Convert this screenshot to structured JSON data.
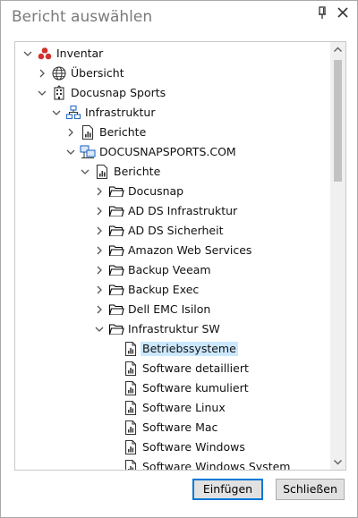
{
  "window": {
    "title": "Bericht auswählen"
  },
  "tree": {
    "items": [
      {
        "label": "Inventar",
        "icon": "inventar-icon",
        "expander": "expanded"
      },
      {
        "label": "Übersicht",
        "icon": "globe-icon",
        "expander": "collapsed"
      },
      {
        "label": "Docusnap Sports",
        "icon": "building-icon",
        "expander": "expanded"
      },
      {
        "label": "Infrastruktur",
        "icon": "network-icon",
        "expander": "expanded"
      },
      {
        "label": "Berichte",
        "icon": "report-icon",
        "expander": "collapsed"
      },
      {
        "label": "DOCUSNAPSPORTS.COM",
        "icon": "domain-icon",
        "expander": "expanded"
      },
      {
        "label": "Berichte",
        "icon": "report-icon",
        "expander": "expanded"
      },
      {
        "label": "Docusnap",
        "icon": "folder-icon",
        "expander": "collapsed"
      },
      {
        "label": "AD DS Infrastruktur",
        "icon": "folder-icon",
        "expander": "collapsed"
      },
      {
        "label": "AD DS Sicherheit",
        "icon": "folder-icon",
        "expander": "collapsed"
      },
      {
        "label": "Amazon Web Services",
        "icon": "folder-icon",
        "expander": "collapsed"
      },
      {
        "label": "Backup Veeam",
        "icon": "folder-icon",
        "expander": "collapsed"
      },
      {
        "label": "Backup Exec",
        "icon": "folder-icon",
        "expander": "collapsed"
      },
      {
        "label": "Dell EMC Isilon",
        "icon": "folder-icon",
        "expander": "collapsed"
      },
      {
        "label": "Infrastruktur SW",
        "icon": "folder-icon",
        "expander": "expanded"
      },
      {
        "label": "Betriebssysteme",
        "icon": "report-page-icon",
        "expander": "none",
        "selected": true
      },
      {
        "label": "Software detailliert",
        "icon": "report-page-icon",
        "expander": "none"
      },
      {
        "label": "Software kumuliert",
        "icon": "report-page-icon",
        "expander": "none"
      },
      {
        "label": "Software Linux",
        "icon": "report-page-icon",
        "expander": "none"
      },
      {
        "label": "Software Mac",
        "icon": "report-page-icon",
        "expander": "none"
      },
      {
        "label": "Software Windows",
        "icon": "report-page-icon",
        "expander": "none"
      },
      {
        "label": "Software Windows System",
        "icon": "report-page-icon",
        "expander": "none"
      }
    ]
  },
  "buttons": {
    "insert": "Einfügen",
    "close": "Schließen"
  },
  "colors": {
    "accent": "#0078d7",
    "selection": "#cce8ff",
    "folder": "#000000",
    "inventar": "#d0312d",
    "domain": "#2b6cc4"
  }
}
